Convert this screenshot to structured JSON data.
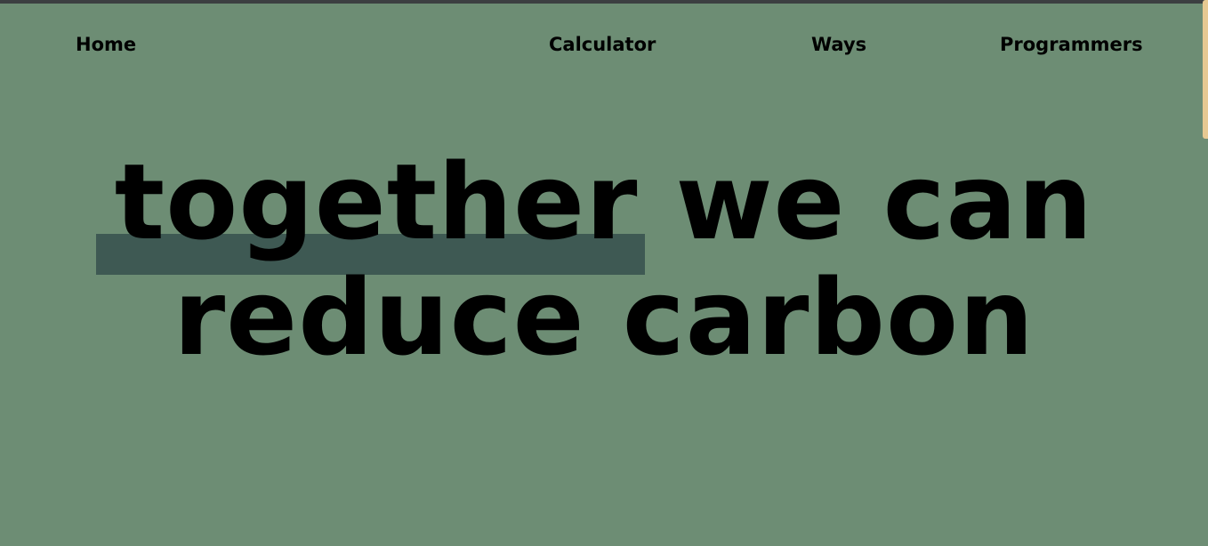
{
  "nav": {
    "home": "Home",
    "calculator": "Calculator",
    "ways": "Ways",
    "programmers": "Programmers"
  },
  "hero": {
    "line1_word1": "together",
    "line1_rest": " we can",
    "line2": "reduce carbon"
  },
  "colors": {
    "background": "#6d8d74",
    "highlight": "#3e5953",
    "text": "#000000",
    "top_bar": "#3c3f41",
    "side_tab": "#e6c992"
  }
}
